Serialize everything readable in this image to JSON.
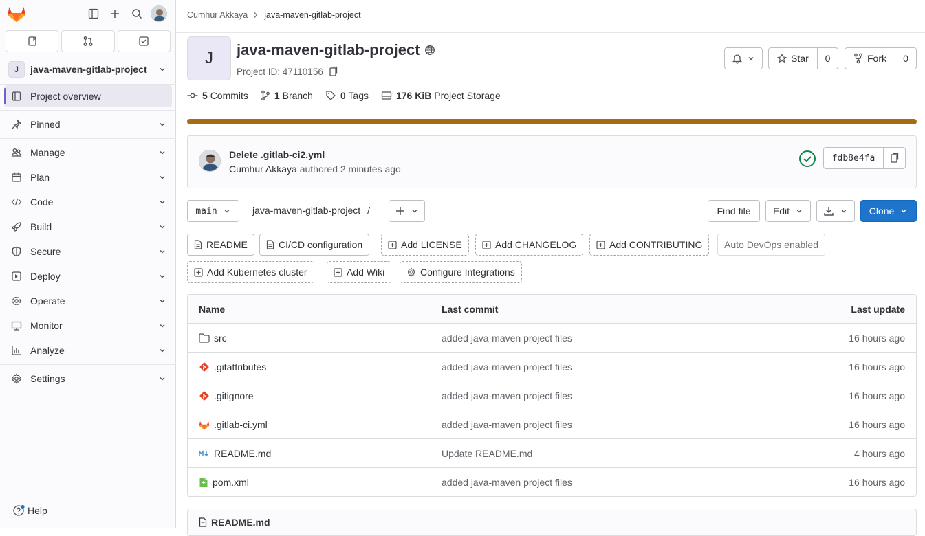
{
  "sidebar": {
    "project_avatar_letter": "J",
    "project_name": "java-maven-gitlab-project",
    "items": [
      {
        "label": "Project overview",
        "icon": "project-icon",
        "active": true
      },
      {
        "label": "Pinned",
        "icon": "pin-icon"
      },
      {
        "label": "Manage",
        "icon": "users-icon"
      },
      {
        "label": "Plan",
        "icon": "planning-icon"
      },
      {
        "label": "Code",
        "icon": "code-icon"
      },
      {
        "label": "Build",
        "icon": "rocket-icon"
      },
      {
        "label": "Secure",
        "icon": "shield-icon"
      },
      {
        "label": "Deploy",
        "icon": "deployments-icon"
      },
      {
        "label": "Operate",
        "icon": "cloud-gear-icon"
      },
      {
        "label": "Monitor",
        "icon": "monitor-icon"
      },
      {
        "label": "Analyze",
        "icon": "chart-icon"
      },
      {
        "label": "Settings",
        "icon": "settings-icon"
      }
    ],
    "help_label": "Help"
  },
  "breadcrumb": {
    "owner": "Cumhur Akkaya",
    "project": "java-maven-gitlab-project"
  },
  "project": {
    "avatar_letter": "J",
    "title": "java-maven-gitlab-project",
    "id_label": "Project ID: 47110156",
    "star_label": "Star",
    "star_count": "0",
    "fork_label": "Fork",
    "fork_count": "0"
  },
  "stats": {
    "commits_count": "5",
    "commits_label": "Commits",
    "branch_count": "1",
    "branch_label": "Branch",
    "tags_count": "0",
    "tags_label": "Tags",
    "storage_size": "176 KiB",
    "storage_label": "Project Storage"
  },
  "language_bar": {
    "fraction": 1.0,
    "color": "#a86b15"
  },
  "last_commit": {
    "title": "Delete .gitlab-ci2.yml",
    "author": "Cumhur Akkaya",
    "authored_text": "authored 2 minutes ago",
    "sha": "fdb8e4fa",
    "status": "passed"
  },
  "repo": {
    "branch": "main",
    "path": "java-maven-gitlab-project",
    "path_separator": "/",
    "find_file": "Find file",
    "edit": "Edit",
    "clone": "Clone"
  },
  "quick_actions": {
    "readme": "README",
    "cicd": "CI/CD configuration",
    "license": "Add LICENSE",
    "changelog": "Add CHANGELOG",
    "contributing": "Add CONTRIBUTING",
    "autodevops": "Auto DevOps enabled",
    "kubernetes": "Add Kubernetes cluster",
    "wiki": "Add Wiki",
    "integrations": "Configure Integrations"
  },
  "files_table": {
    "headers": {
      "name": "Name",
      "last_commit": "Last commit",
      "last_update": "Last update"
    },
    "rows": [
      {
        "name": "src",
        "icon": "folder-icon",
        "commit": "added java-maven project files",
        "updated": "16 hours ago"
      },
      {
        "name": ".gitattributes",
        "icon": "git-icon",
        "commit": "added java-maven project files",
        "updated": "16 hours ago"
      },
      {
        "name": ".gitignore",
        "icon": "git-icon",
        "commit": "added java-maven project files",
        "updated": "16 hours ago"
      },
      {
        "name": ".gitlab-ci.yml",
        "icon": "gitlab-icon",
        "commit": "added java-maven project files",
        "updated": "16 hours ago"
      },
      {
        "name": "README.md",
        "icon": "markdown-icon",
        "commit": "Update README.md",
        "updated": "4 hours ago"
      },
      {
        "name": "pom.xml",
        "icon": "maven-file-icon",
        "commit": "added java-maven project files",
        "updated": "16 hours ago"
      }
    ]
  },
  "readme_panel": {
    "title": "README.md"
  }
}
